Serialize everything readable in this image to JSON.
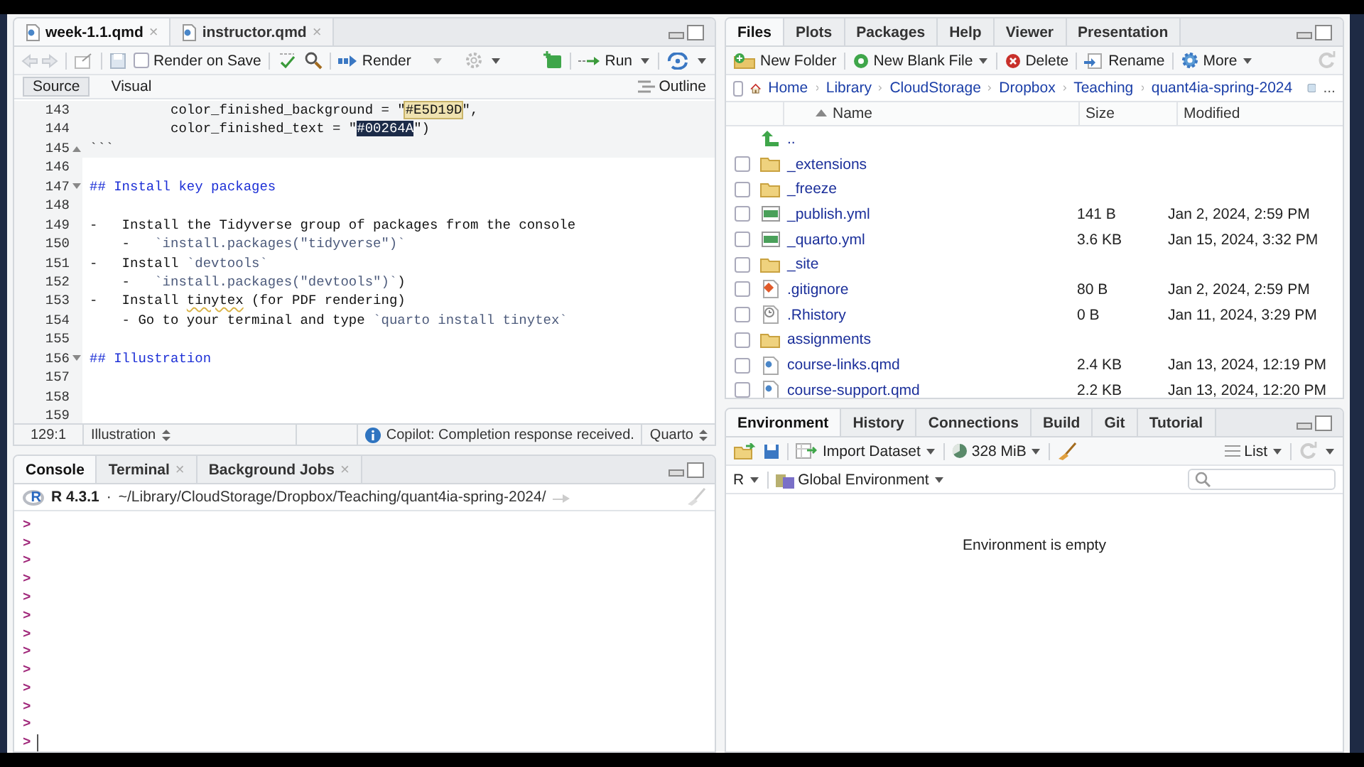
{
  "editor": {
    "tabs": [
      {
        "label": "week-1.1.qmd",
        "selected": true,
        "close": "×"
      },
      {
        "label": "instructor.qmd",
        "selected": false,
        "close": "×"
      }
    ],
    "render_on_save": {
      "label": "Render on Save",
      "checked": false
    },
    "render": "Render",
    "run": "Run",
    "modes": [
      {
        "label": "Source",
        "selected": true
      },
      {
        "label": "Visual",
        "selected": false
      }
    ],
    "outline": "Outline",
    "lines": [
      {
        "num": "143",
        "chunk": true,
        "segs": [
          {
            "t": "          color_finished_background = \"",
            "kind": "plain"
          },
          {
            "t": "#E5D19D",
            "kind": "match"
          },
          {
            "t": "\",",
            "kind": "plain"
          }
        ]
      },
      {
        "num": "144",
        "chunk": true,
        "segs": [
          {
            "t": "          color_finished_text = \"",
            "kind": "plain"
          },
          {
            "t": "#00264A",
            "kind": "selected"
          },
          {
            "t": "\")",
            "kind": "plain"
          }
        ]
      },
      {
        "num": "145",
        "chunk": true,
        "fold": {
          "kind": "up"
        },
        "segs": [
          {
            "t": "```",
            "kind": "plain"
          }
        ]
      },
      {
        "num": "146",
        "chunk": false
      },
      {
        "num": "147",
        "chunk": false,
        "fold": {
          "kind": "down"
        },
        "segs": [
          {
            "t": "## Install key packages",
            "kind": "heading"
          }
        ]
      },
      {
        "num": "148",
        "chunk": false
      },
      {
        "num": "149",
        "chunk": false,
        "segs": [
          {
            "t": "-   Install the Tidyverse group of packages from the console",
            "kind": "plain"
          }
        ]
      },
      {
        "num": "150",
        "chunk": false,
        "segs": [
          {
            "t": "    -   ",
            "kind": "plain"
          },
          {
            "t": "`install.packages(\"tidyverse\")`",
            "kind": "code"
          }
        ]
      },
      {
        "num": "151",
        "chunk": false,
        "segs": [
          {
            "t": "-   Install ",
            "kind": "plain"
          },
          {
            "t": "`devtools`",
            "kind": "code"
          }
        ]
      },
      {
        "num": "152",
        "chunk": false,
        "segs": [
          {
            "t": "    -   ",
            "kind": "plain"
          },
          {
            "t": "`install.packages(\"devtools\")`",
            "kind": "code"
          },
          {
            "t": ")",
            "kind": "plain"
          }
        ]
      },
      {
        "num": "153",
        "chunk": false,
        "segs": [
          {
            "t": "-   Install ",
            "kind": "plain"
          },
          {
            "t": "tinytex",
            "kind": "misspelled"
          },
          {
            "t": " (for PDF rendering)",
            "kind": "plain"
          }
        ]
      },
      {
        "num": "154",
        "chunk": false,
        "segs": [
          {
            "t": "    - Go to your terminal and type ",
            "kind": "plain"
          },
          {
            "t": "`quarto install tinytex`",
            "kind": "code"
          }
        ]
      },
      {
        "num": "155",
        "chunk": false
      },
      {
        "num": "156",
        "chunk": false,
        "fold": {
          "kind": "down"
        },
        "segs": [
          {
            "t": "## Illustration",
            "kind": "heading"
          }
        ]
      },
      {
        "num": "157",
        "chunk": false
      },
      {
        "num": "158",
        "chunk": false
      },
      {
        "num": "159",
        "chunk": false
      }
    ],
    "status": {
      "position": "129:1",
      "section": "Illustration",
      "message": "Copilot: Completion response received.",
      "language": "Quarto"
    }
  },
  "console": {
    "tabs": [
      {
        "label": "Console",
        "selected": true
      },
      {
        "label": "Terminal",
        "selected": false,
        "close": "×"
      },
      {
        "label": "Background Jobs",
        "selected": false,
        "close": "×"
      }
    ],
    "logo": "R",
    "version": "R 4.3.1",
    "separator": "·",
    "path": "~/Library/CloudStorage/Dropbox/Teaching/quant4ia-spring-2024/",
    "prompts": [
      ">",
      ">",
      ">",
      ">",
      ">",
      ">",
      ">",
      ">",
      ">",
      ">",
      ">",
      ">",
      ">"
    ]
  },
  "files": {
    "tabs": [
      {
        "label": "Files",
        "selected": true
      },
      {
        "label": "Plots",
        "selected": false
      },
      {
        "label": "Packages",
        "selected": false
      },
      {
        "label": "Help",
        "selected": false
      },
      {
        "label": "Viewer",
        "selected": false
      },
      {
        "label": "Presentation",
        "selected": false
      }
    ],
    "toolbar": [
      {
        "label": "New Folder",
        "kind": "folder",
        "dropdown": false
      },
      {
        "label": "New Blank File",
        "kind": "newfile",
        "dropdown": true
      },
      {
        "label": "Delete",
        "kind": "delete",
        "dropdown": false
      },
      {
        "label": "Rename",
        "kind": "rename",
        "dropdown": false
      },
      {
        "label": "More",
        "kind": "gear",
        "dropdown": true
      }
    ],
    "select_all": {
      "checked": false
    },
    "breadcrumb": [
      "Home",
      "Library",
      "CloudStorage",
      "Dropbox",
      "Teaching",
      "quant4ia-spring-2024"
    ],
    "overflow": "...",
    "columns": [
      "Name",
      "Size",
      "Modified"
    ],
    "rows": [
      {
        "name": "..",
        "kind": "up"
      },
      {
        "name": "_extensions",
        "kind": "folder",
        "checked": false
      },
      {
        "name": "_freeze",
        "kind": "folder",
        "checked": false
      },
      {
        "name": "_publish.yml",
        "kind": "yml",
        "checked": false,
        "size": "141 B",
        "modified": "Jan 2, 2024, 2:59 PM"
      },
      {
        "name": "_quarto.yml",
        "kind": "yml",
        "checked": false,
        "size": "3.6 KB",
        "modified": "Jan 15, 2024, 3:32 PM"
      },
      {
        "name": "_site",
        "kind": "folder",
        "checked": false
      },
      {
        "name": ".gitignore",
        "kind": "git",
        "checked": false,
        "size": "80 B",
        "modified": "Jan 2, 2024, 2:59 PM"
      },
      {
        "name": ".Rhistory",
        "kind": "history",
        "checked": false,
        "size": "0 B",
        "modified": "Jan 11, 2024, 3:29 PM"
      },
      {
        "name": "assignments",
        "kind": "folder",
        "checked": false
      },
      {
        "name": "course-links.qmd",
        "kind": "qmd",
        "checked": false,
        "size": "2.4 KB",
        "modified": "Jan 13, 2024, 12:19 PM"
      },
      {
        "name": "course-support.qmd",
        "kind": "qmd",
        "checked": false,
        "size": "2.2 KB",
        "modified": "Jan 13, 2024, 12:20 PM"
      }
    ]
  },
  "environment": {
    "tabs": [
      {
        "label": "Environment",
        "selected": true
      },
      {
        "label": "History",
        "selected": false
      },
      {
        "label": "Connections",
        "selected": false
      },
      {
        "label": "Build",
        "selected": false
      },
      {
        "label": "Git",
        "selected": false
      },
      {
        "label": "Tutorial",
        "selected": false
      }
    ],
    "import": "Import Dataset",
    "memory": "328 MiB",
    "view": "List",
    "language": "R",
    "scope": "Global Environment",
    "empty": "Environment is empty"
  }
}
